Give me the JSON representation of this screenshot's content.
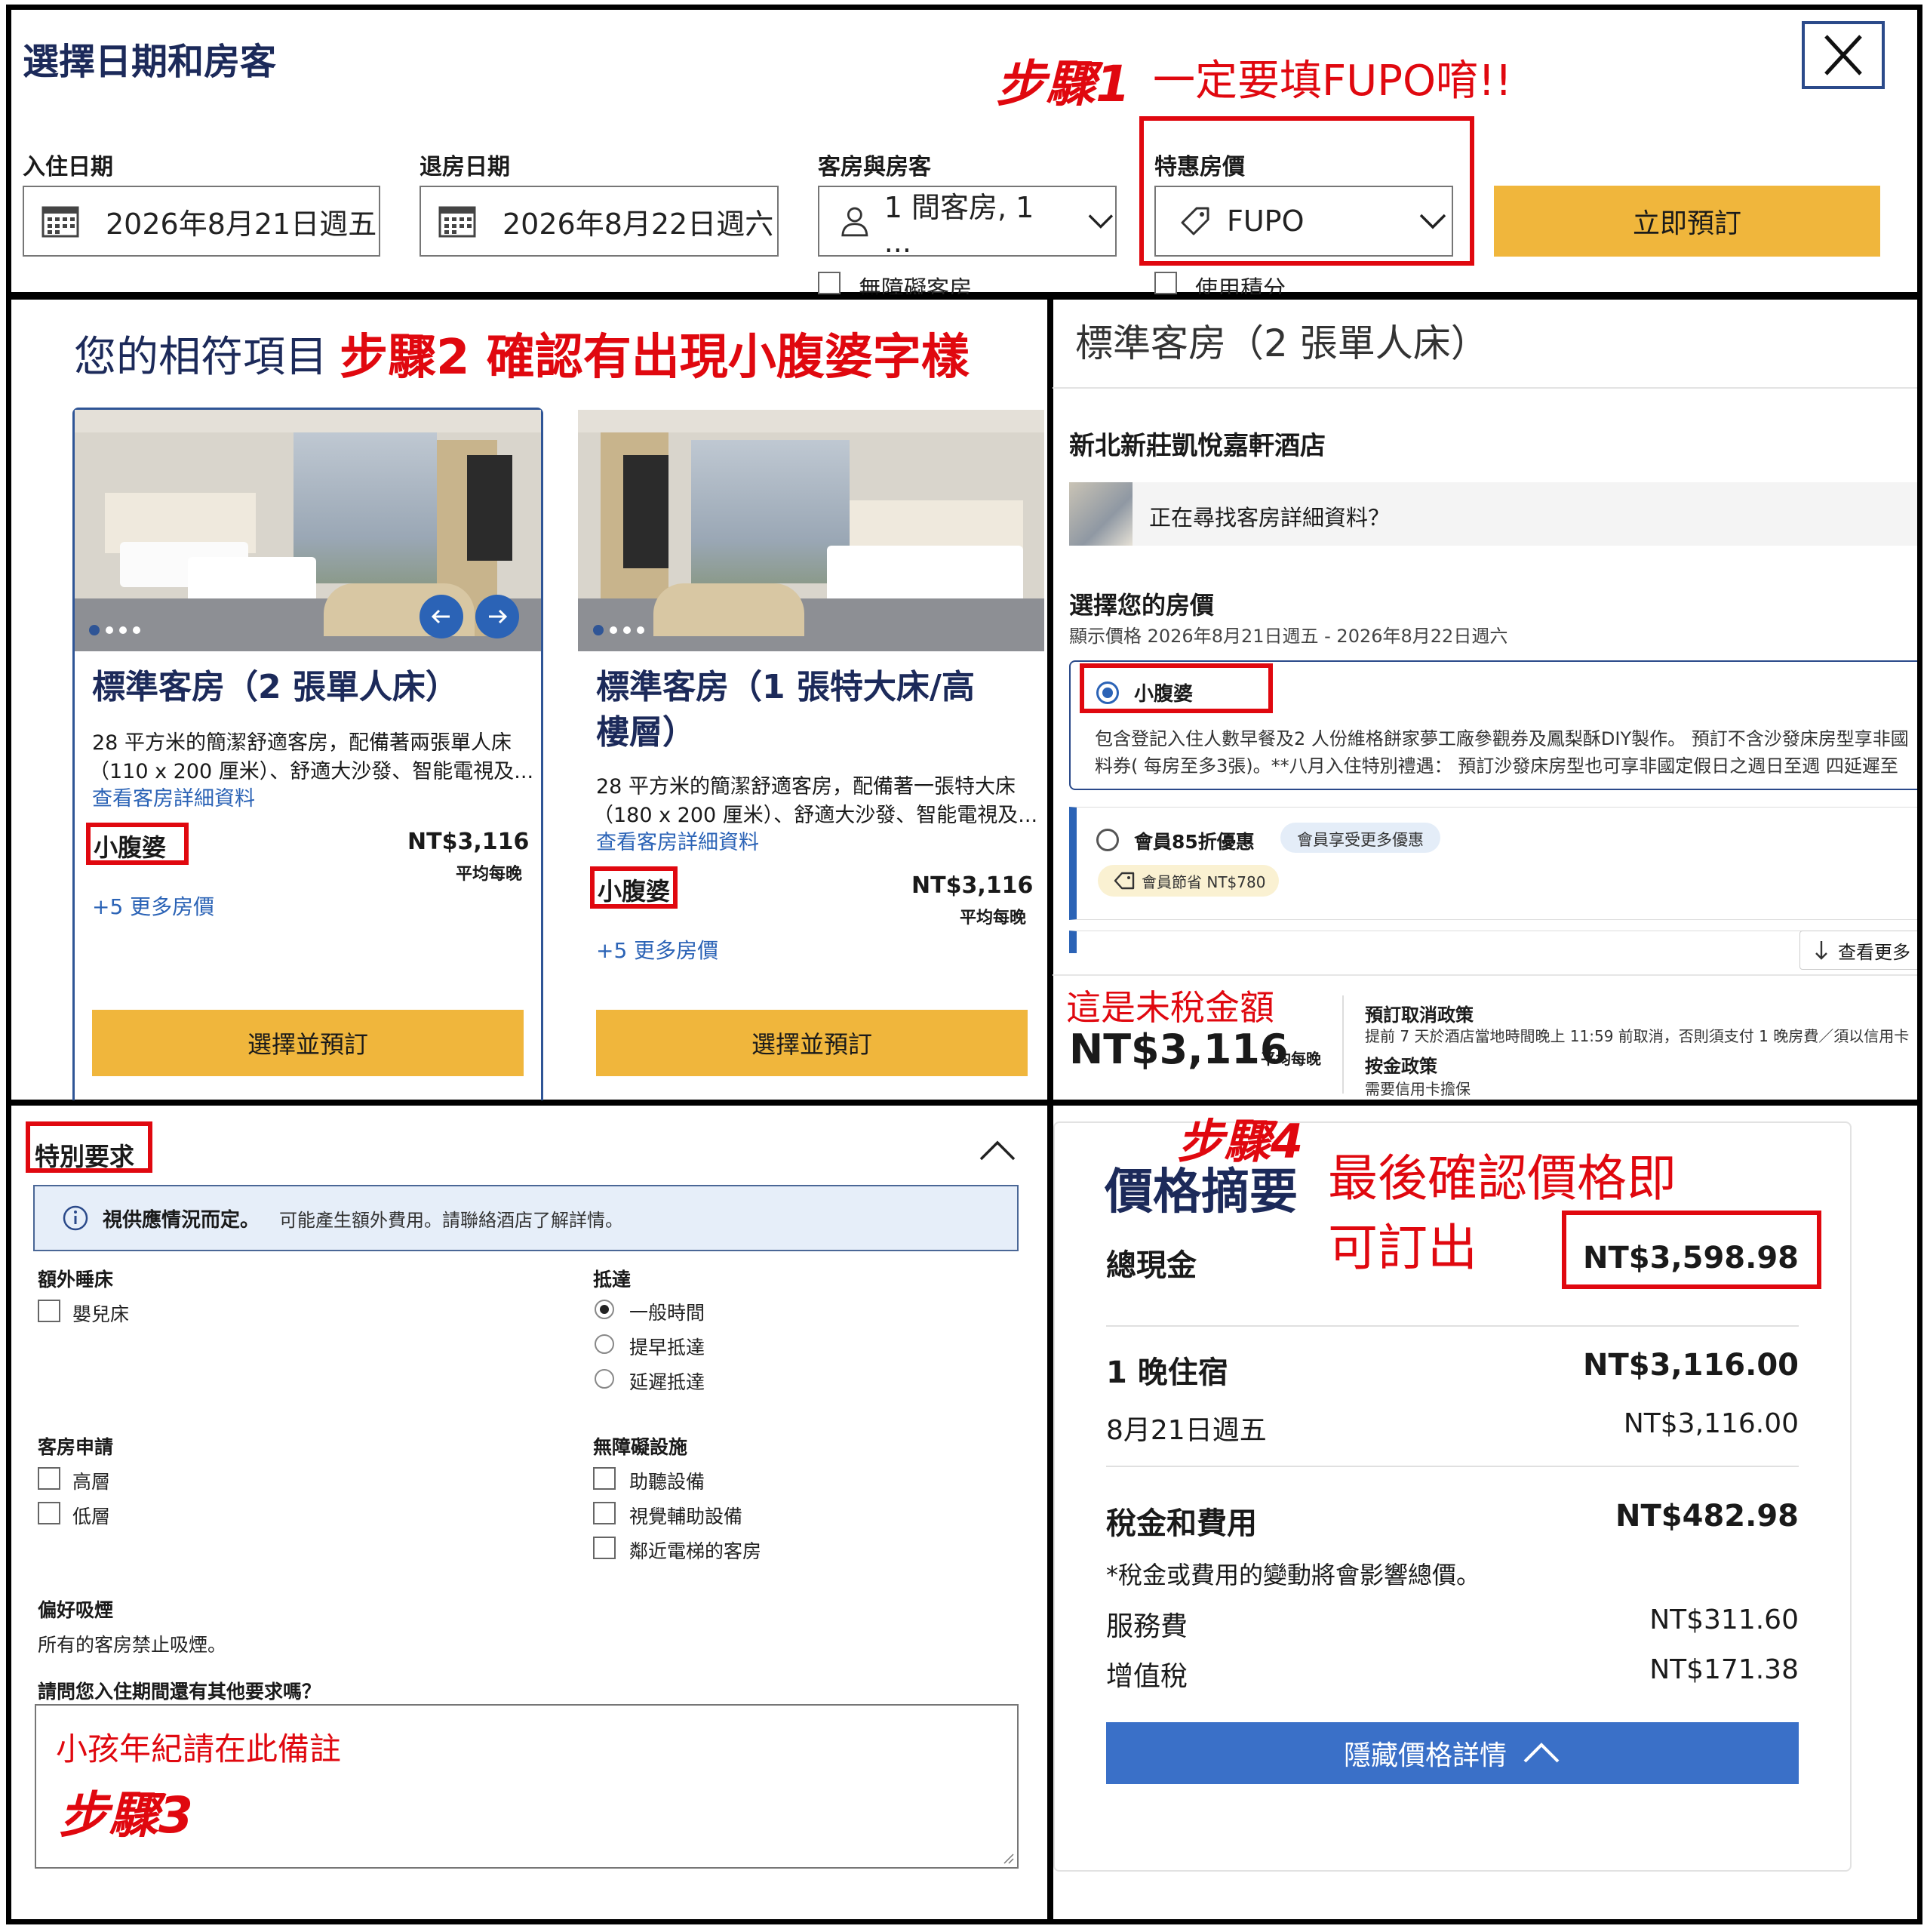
{
  "search": {
    "title": "選擇日期和房客",
    "checkin_label": "入住日期",
    "checkin_value": "2026年8月21日週五",
    "checkout_label": "退房日期",
    "checkout_value": "2026年8月22日週六",
    "guests_label": "客房與房客",
    "guests_value": "1 間客房, 1 ...",
    "special_rate_label": "特惠房價",
    "special_rate_value": "FUPO",
    "book_button": "立即預訂",
    "accessible_label": "無障礙客房",
    "points_label": "使用積分"
  },
  "annotations": {
    "step1": "步驟1",
    "step1_note": "一定要填FUPO唷!!",
    "step2_prefix": "您的相符項目",
    "step2": "步驟2 確認有出現小腹婆字樣",
    "step3_note": "小孩年紀請在此備註",
    "step3": "步驟3",
    "step4": "步驟4",
    "step4_note_line1": "最後確認價格即",
    "step4_note_line2": "可訂出",
    "untaxed_note": "這是未稅金額"
  },
  "rooms": [
    {
      "name": "標準客房（2 張單人床）",
      "desc_line1": "28 平方米的簡潔舒適客房，配備著兩張單人床",
      "desc_line2": "（110 x 200 厘米）、舒適大沙發、智能電視及...",
      "details_link": "查看客房詳細資料",
      "rate_name": "小腹婆",
      "price": "NT$3,116",
      "price_unit": "平均每晚",
      "more_rates": "+5 更多房價",
      "select_button": "選擇並預訂"
    },
    {
      "name_line1": "標準客房（1 張特大床/高",
      "name_line2": "樓層）",
      "desc_line1": "28 平方米的簡潔舒適客房，配備著一張特大床",
      "desc_line2": "（180 x 200 厘米）、舒適大沙發、智能電視及...",
      "details_link": "查看客房詳細資料",
      "rate_name": "小腹婆",
      "price": "NT$3,116",
      "price_unit": "平均每晚",
      "more_rates": "+5 更多房價",
      "select_button": "選擇並預訂"
    }
  ],
  "room_detail": {
    "title": "標準客房（2 張單人床）",
    "hotel_name": "新北新莊凱悅嘉軒酒店",
    "looking_for_details": "正在尋找客房詳細資料？",
    "choose_rate_title": "選擇您的房價",
    "dates_shown": "顯示價格 2026年8月21日週五 - 2026年8月22日週六",
    "rate1_name": "小腹婆",
    "rate1_desc_line1": "包含登記入住人數早餐及2 人份維格餅家夢工廠參觀券及鳳梨酥DIY製作。 預訂不含沙發床房型享非國",
    "rate1_desc_line2": "料券( 每房至多3張)。**八月入住特別禮遇： 預訂沙發床房型也可享非國定假日之週日至週 四延遲至",
    "rate2_name": "會員85折優惠",
    "rate2_badge": "會員享受更多優惠",
    "rate2_saving": "會員節省 NT$780",
    "view_more": "查看更多",
    "price": "NT$3,116",
    "price_unit": "平均每晚",
    "cancel_policy_title": "預訂取消政策",
    "cancel_policy_text": "提前 7 天於酒店當地時間晚上 11:59 前取消，否則須支付 1 晚房費／須以信用卡",
    "deposit_title": "按金政策",
    "deposit_text": "需要信用卡擔保"
  },
  "special_requests": {
    "title": "特別要求",
    "notice_bold": "視供應情況而定。",
    "notice_text": "可能產生額外費用。請聯絡酒店了解詳情。",
    "extra_bed_title": "額外睡床",
    "crib": "嬰兒床",
    "arrival_title": "抵達",
    "arrival_normal": "一般時間",
    "arrival_early": "提早抵達",
    "arrival_late": "延遲抵達",
    "room_request_title": "客房申請",
    "high_floor": "高層",
    "low_floor": "低層",
    "accessibility_title": "無障礙設施",
    "hearing": "助聽設備",
    "visual": "視覺輔助設備",
    "near_elevator": "鄰近電梯的客房",
    "smoking_title": "偏好吸煙",
    "smoking_text": "所有的客房禁止吸煙。",
    "other_requests_label": "請問您入住期間還有其他要求嗎？"
  },
  "price_summary": {
    "title": "價格摘要",
    "total_label": "總現金",
    "total_value": "NT$3,598.98",
    "stay_label": "1 晚住宿",
    "stay_value": "NT$3,116.00",
    "night_date": "8月21日週五",
    "night_value": "NT$3,116.00",
    "taxes_label": "稅金和費用",
    "taxes_value": "NT$482.98",
    "tax_note": "*稅金或費用的變動將會影響總價。",
    "service_label": "服務費",
    "service_value": "NT$311.60",
    "vat_label": "增值稅",
    "vat_value": "NT$171.38",
    "hide_button": "隱藏價格詳情"
  },
  "colors": {
    "accent_yellow": "#f0b63c",
    "annotation_red": "#e0080f",
    "brand_navy": "#1c2a5a",
    "link_blue": "#2b63b6",
    "button_blue": "#3a70c8"
  }
}
